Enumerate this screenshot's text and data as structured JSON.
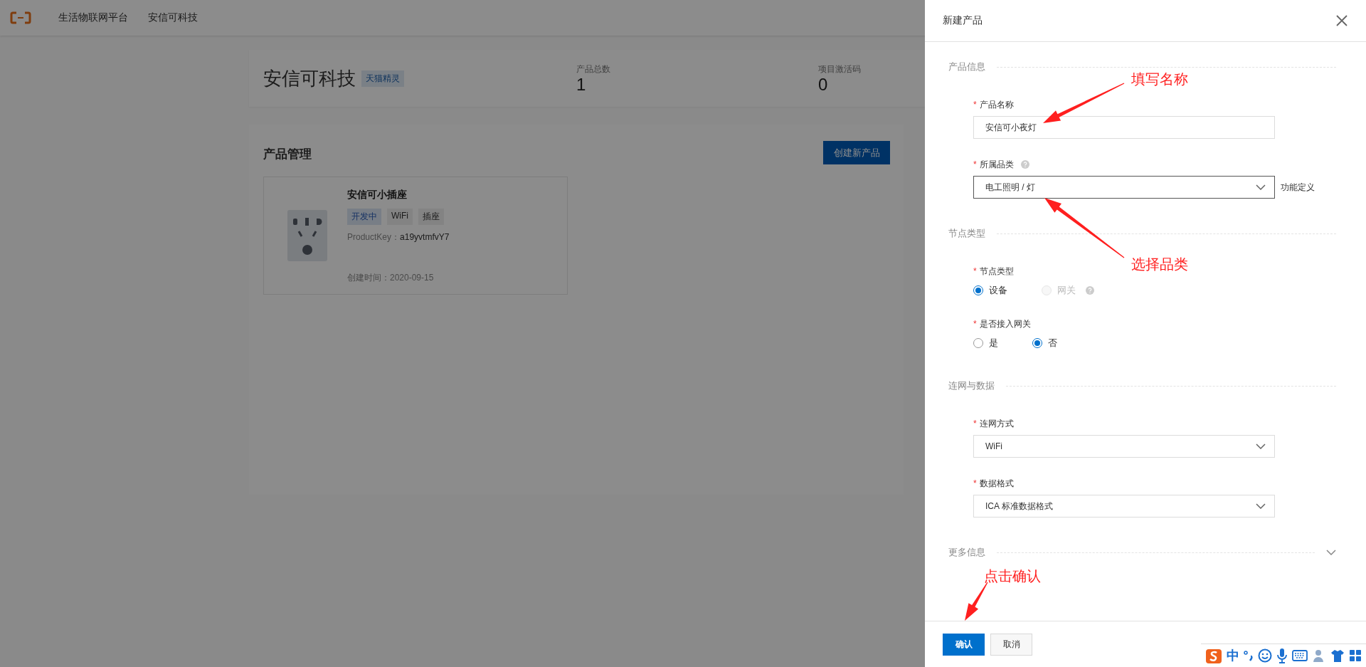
{
  "header": {
    "nav": [
      {
        "label": "生活物联网平台"
      },
      {
        "label": "安信可科技"
      }
    ]
  },
  "summary": {
    "name": "安信可科技",
    "tag": "天猫精灵",
    "stats": [
      {
        "label": "产品总数",
        "value": "1"
      },
      {
        "label": "项目激活码",
        "value": "0"
      }
    ]
  },
  "products": {
    "title": "产品管理",
    "create_button": "创建新产品",
    "cards": [
      {
        "name": "安信可小插座",
        "tags": [
          {
            "label": "开发中",
            "kind": "status"
          },
          {
            "label": "WiFi",
            "kind": "plain"
          },
          {
            "label": "插座",
            "kind": "plain"
          }
        ],
        "product_key_label": "ProductKey：",
        "product_key": "a19yvtmfvY7",
        "created": "创建时间：2020-09-15"
      }
    ]
  },
  "drawer": {
    "title": "新建产品",
    "sections": [
      {
        "title": "产品信息",
        "fields": [
          {
            "kind": "input",
            "label": "产品名称",
            "required_mark": "*",
            "value": "安信可小夜灯"
          },
          {
            "kind": "select",
            "label": "所属品类",
            "required_mark": "*",
            "help": true,
            "focused": true,
            "value": "电工照明 / 灯",
            "suffix": "功能定义"
          }
        ]
      },
      {
        "title": "节点类型",
        "fields": [
          {
            "kind": "radio",
            "label": "节点类型",
            "required_mark": "*",
            "options": [
              {
                "label": "设备",
                "selected": true,
                "disabled": false
              },
              {
                "label": "网关",
                "selected": false,
                "disabled": true,
                "help": true
              }
            ]
          },
          {
            "kind": "radio",
            "label": "是否接入网关",
            "required_mark": "*",
            "options": [
              {
                "label": "是",
                "selected": false,
                "disabled": false
              },
              {
                "label": "否",
                "selected": true,
                "disabled": false
              }
            ]
          }
        ]
      },
      {
        "title": "连网与数据",
        "fields": [
          {
            "kind": "select",
            "label": "连网方式",
            "required_mark": "*",
            "focused": false,
            "value": "WiFi"
          },
          {
            "kind": "select",
            "label": "数据格式",
            "required_mark": "*",
            "focused": false,
            "value": "ICA 标准数据格式"
          }
        ]
      }
    ],
    "more": {
      "title": "更多信息",
      "expanded": false
    },
    "buttons": [
      {
        "label": "确认",
        "kind": "primary"
      },
      {
        "label": "取消",
        "kind": "default"
      }
    ]
  },
  "annotations": [
    {
      "text": "填写名称"
    },
    {
      "text": "选择品类"
    },
    {
      "text": "点击确认"
    }
  ],
  "ime": {
    "mode": "中"
  }
}
